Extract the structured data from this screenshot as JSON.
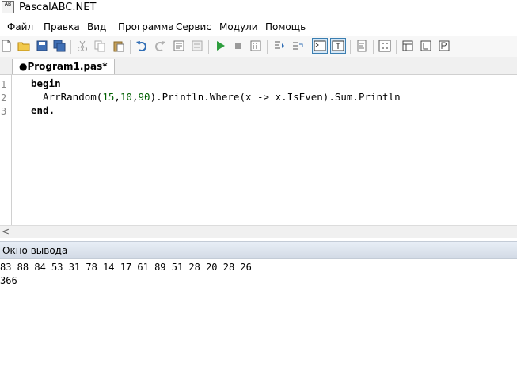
{
  "window": {
    "title": "PascalABC.NET",
    "icon_text": "AB"
  },
  "menu": [
    "Файл",
    "Правка",
    "Вид",
    "Программа",
    "Сервис",
    "Модули",
    "Помощь"
  ],
  "tab": {
    "label": "●Program1.pas*"
  },
  "editor": {
    "lines": [
      {
        "number": "1",
        "text": "begin"
      },
      {
        "number": "2",
        "text": "  ArrRandom(15,10,90).Println.Where(x -> x.IsEven).Sum.Println"
      },
      {
        "number": "3",
        "text": "end."
      }
    ]
  },
  "scroll": {
    "left_arrow": "<"
  },
  "output": {
    "title": "Окно вывода",
    "lines": [
      "83 88 84 53 31 78 14 17 61 89 51 28 20 28 26",
      "366"
    ]
  },
  "colors": {
    "accent": "#3c7fb1",
    "number": "#006000",
    "output_header": "#d3dbe6"
  }
}
